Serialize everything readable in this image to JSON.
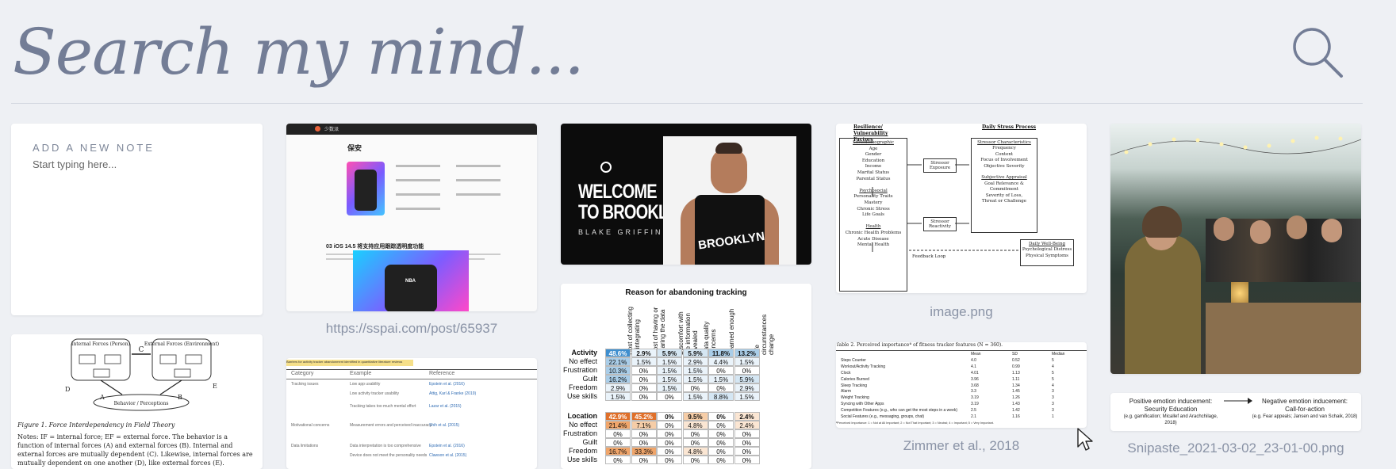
{
  "search": {
    "placeholder": "Search my mind..."
  },
  "new_note": {
    "label": "ADD A NEW NOTE",
    "placeholder": "Start typing here..."
  },
  "cards": {
    "sspai": {
      "caption": "https://sspai.com/post/65937",
      "brand": "少数派",
      "author": "保安",
      "title": "03 iOS 14.5 将支持应用跟踪透明度功能",
      "phone_badge": "NBA"
    },
    "brooklyn": {
      "line1": "WELCOME",
      "line2": "TO BROOKLYN",
      "player": "BLAKE GRIFFIN",
      "jersey": "BROOKLYN"
    },
    "stress": {
      "caption": "image.png",
      "left_head": "Resilience/ Vulnerability Factors",
      "right_head": "Daily Stress Process",
      "left_items": [
        "Sociodemographic",
        "Age",
        "Gender",
        "Education",
        "Income",
        "Marital Status",
        "Parental Status",
        "",
        "Psychosocial",
        "Personality Traits",
        "Mastery",
        "Chronic Stress",
        "Life Goals",
        "",
        "Health",
        "Chronic Health Problems",
        "Acute Disease",
        "Mental Health"
      ],
      "stressor_exposure": "Stressor Exposure",
      "stressor_reactivity": "Stressor Reactivity",
      "box1": [
        "Stressor Characteristics",
        "Frequency",
        "Content",
        "Focus of Involvement",
        "Objective Severity"
      ],
      "box2": [
        "Subjective Appraisal",
        "Goal Relevance &",
        "Commitment",
        "Severity of Loss,",
        "Threat or Challenge"
      ],
      "box3": [
        "Daily Well-Being",
        "Psychological Distress",
        "Physical Symptoms"
      ],
      "feedback": "Feedback Loop"
    },
    "tracking": {
      "title": "Reason for abandoning tracking",
      "columns": [
        "Cost of collecting & integrating",
        "Cost of having or sharing the data",
        "Discomfort with the information revealed",
        "Data quality concerns",
        "Learned enough",
        "Life circumstances change"
      ],
      "sections": [
        {
          "rows": [
            {
              "label": "Activity",
              "values": [
                "48.6%",
                "2.9%",
                "5.9%",
                "5.9%",
                "11.8%",
                "13.2%"
              ]
            },
            {
              "label": "No effect",
              "values": [
                "22.1%",
                "1.5%",
                "1.5%",
                "2.9%",
                "4.4%",
                "1.5%"
              ]
            },
            {
              "label": "Frustration",
              "values": [
                "10.3%",
                "0%",
                "1.5%",
                "1.5%",
                "0%",
                "0%"
              ]
            },
            {
              "label": "Guilt",
              "values": [
                "16.2%",
                "0%",
                "1.5%",
                "1.5%",
                "1.5%",
                "5.9%"
              ]
            },
            {
              "label": "Freedom",
              "values": [
                "2.9%",
                "0%",
                "1.5%",
                "0%",
                "0%",
                "2.9%"
              ]
            },
            {
              "label": "Use skills",
              "values": [
                "1.5%",
                "0%",
                "0%",
                "1.5%",
                "8.8%",
                "1.5%"
              ]
            }
          ]
        },
        {
          "rows": [
            {
              "label": "Location",
              "values": [
                "42.9%",
                "45.2%",
                "0%",
                "9.5%",
                "0%",
                "2.4%"
              ]
            },
            {
              "label": "No effect",
              "values": [
                "21.4%",
                "7.1%",
                "0%",
                "4.8%",
                "0%",
                "2.4%"
              ]
            },
            {
              "label": "Frustration",
              "values": [
                "0%",
                "0%",
                "0%",
                "0%",
                "0%",
                "0%"
              ]
            },
            {
              "label": "Guilt",
              "values": [
                "0%",
                "0%",
                "0%",
                "0%",
                "0%",
                "0%"
              ]
            },
            {
              "label": "Freedom",
              "values": [
                "16.7%",
                "33.3%",
                "0%",
                "4.8%",
                "0%",
                "0%"
              ]
            },
            {
              "label": "Use skills",
              "values": [
                "0%",
                "0%",
                "0%",
                "0%",
                "0%",
                "0%"
              ]
            }
          ]
        }
      ]
    },
    "fitness": {
      "caption": "Zimmer et al., 2018",
      "title": "Table 2.  Perceived importanceª of fitness tracker features (N = 360).",
      "headers": [
        "",
        "Mean",
        "SD",
        "Median"
      ],
      "rows": [
        [
          "Steps Counter",
          "4.0",
          "0.52",
          "5"
        ],
        [
          "Workout/Activity Tracking",
          "4.1",
          "0.99",
          "4"
        ],
        [
          "Clock",
          "4.01",
          "1.13",
          "5"
        ],
        [
          "Calories Burned",
          "3.96",
          "1.11",
          "5"
        ],
        [
          "Sleep Tracking",
          "3.68",
          "1.34",
          "4"
        ],
        [
          "Alarm",
          "3.3",
          "1.45",
          "3"
        ],
        [
          "Weight Tracking",
          "3.19",
          "1.26",
          "3"
        ],
        [
          "Syncing with Other Apps",
          "3.19",
          "1.43",
          "3"
        ],
        [
          "Competition Features (e.g., who can get the most steps in a week)",
          "2.5",
          "1.42",
          "3"
        ],
        [
          "Social Features (e.g., messaging, groups, chat)",
          "2.1",
          "1.16",
          "1"
        ]
      ],
      "footnote": "ªPerceived Importance: 1 = Not at All Important; 2 = Not That Important; 3 = Neutral; 4 = Important; 5 = Very Important."
    },
    "photo": {},
    "snipaste": {
      "caption": "Snipaste_2021-03-02_23-01-00.png",
      "left_title": "Positive emotion inducement:",
      "left_sub": "Security Education",
      "left_ref": "(e.g. gamification; Micallef and Arachchilage, 2018)",
      "right_title": "Negative emotion inducement:",
      "right_sub": "Call-for-action",
      "right_ref": "(e.g. Fear appeals; Jansen and van Schaik, 2018)"
    },
    "field_theory": {
      "internal": "Internal Forces (Person)",
      "external": "External Forces (Environment)",
      "behavior": "Behavior / Perceptions",
      "caption": "Figure 1. Force Interdependency in Field Theory",
      "notes": "Notes: IF = internal force; EF = external force. The behavior is a function of internal forces (A) and external forces (B). Internal and external forces are mutually dependent (C). Likewise, internal forces are mutually dependent on one another (D), like external forces (E)."
    },
    "barriers": {
      "headline": "Barriers for activity tracker abandonment identified in quantitative literature reviews",
      "headers": [
        "Category",
        "Example",
        "Reference"
      ],
      "rows": [
        [
          "Tracking issues",
          "Low app usability",
          "Epstein et al. (2016)"
        ],
        [
          "",
          "Low activity tracker usability",
          "Attig, Karl & Franke (2019)"
        ],
        [
          "",
          "Tracking takes too much mental effort",
          "Lazar et al. (2015)"
        ],
        [
          "Motivational concerns",
          "Measurement errors and perceived inaccuracy",
          "Shih et al. (2015)"
        ],
        [
          "Data limitations",
          "Data interpretation is too comprehensive",
          "Epstein et al. (2016)"
        ],
        [
          "",
          "Device does not meet the personality needs",
          "Clawson et al. (2015)"
        ]
      ]
    }
  }
}
